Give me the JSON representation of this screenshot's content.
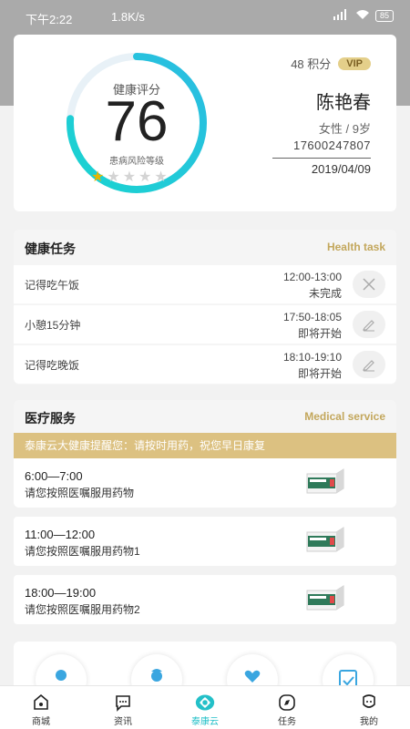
{
  "status_bar": {
    "time": "下午2:22",
    "speed": "1.8K/s",
    "signal": "HD",
    "battery": "85"
  },
  "profile": {
    "score_title": "健康评分",
    "score": "76",
    "score_fraction": 0.76,
    "risk_label": "患病风险等级",
    "risk_stars": 1,
    "risk_stars_total": 5,
    "points": "48 积分",
    "vip": "VIP",
    "name": "陈艳春",
    "gender_age": "女性 / 9岁",
    "phone": "17600247807",
    "date": "2019/04/09",
    "colors": {
      "gauge_start": "#19d4d0",
      "gauge_end": "#2bbce2",
      "gauge_track": "#e8f1f7"
    }
  },
  "health_task": {
    "title": "健康任务",
    "subtitle": "Health task",
    "items": [
      {
        "name": "记得吃午饭",
        "time": "12:00-13:00",
        "status": "未完成",
        "action_icon": "close-icon"
      },
      {
        "name": "小憩15分钟",
        "time": "17:50-18:05",
        "status": "即将开始",
        "action_icon": "edit-icon"
      },
      {
        "name": "记得吃晚饭",
        "time": "18:10-19:10",
        "status": "即将开始",
        "action_icon": "edit-icon"
      }
    ]
  },
  "medical_service": {
    "title": "医疗服务",
    "subtitle": "Medical service",
    "reminder": "泰康云大健康提醒您：请按时用药，祝您早日康复",
    "items": [
      {
        "time": "6:00—7:00",
        "text": "请您按照医嘱服用药物",
        "image": "medicine-box-icon"
      },
      {
        "time": "11:00—12:00",
        "text": "请您按照医嘱服用药物1",
        "image": "medicine-box-icon"
      },
      {
        "time": "18:00—19:00",
        "text": "请您按照医嘱服用药物2",
        "image": "medicine-box-icon"
      }
    ]
  },
  "services": [
    "doctor-icon",
    "nurse-icon",
    "heart-hand-icon",
    "clipboard-icon"
  ],
  "nav": [
    {
      "label": "商城",
      "icon": "home-icon"
    },
    {
      "label": "资讯",
      "icon": "chat-icon"
    },
    {
      "label": "泰康云",
      "icon": "cloud-logo-icon",
      "active": true
    },
    {
      "label": "任务",
      "icon": "compass-icon"
    },
    {
      "label": "我的",
      "icon": "profile-icon"
    }
  ],
  "accent": "#23c0c8",
  "gold": "#c3a75c"
}
